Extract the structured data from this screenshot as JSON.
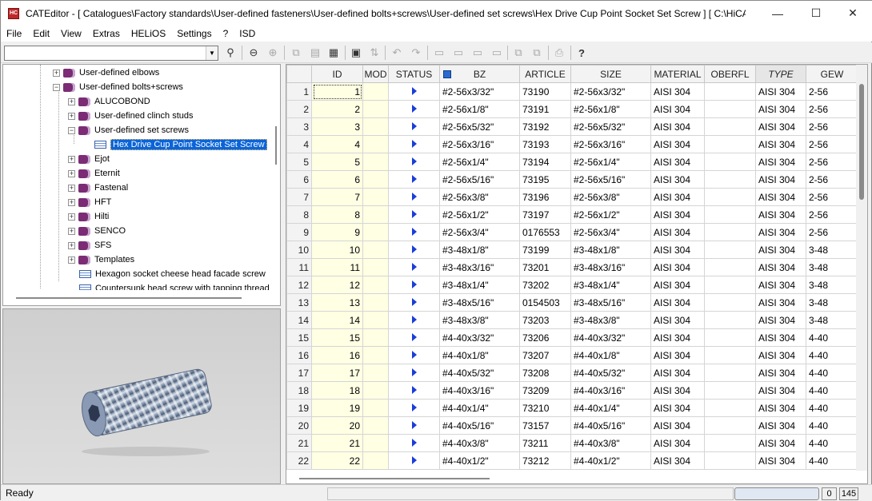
{
  "window": {
    "title": "CATEditor - [ Catalogues\\Factory standards\\User-defined fasteners\\User-defined bolts+screws\\User-defined  set screws\\Hex Drive Cup Point Socket Set Screw ]     [ C:\\HiCA...",
    "app_icon": "HiCAD",
    "minimize_glyph": "—",
    "maximize_glyph": "☐",
    "close_glyph": "✕"
  },
  "menu": [
    "File",
    "Edit",
    "View",
    "Extras",
    "HELiOS",
    "Settings",
    "?",
    "ISD"
  ],
  "toolbar": {
    "combo_value": "",
    "icons": [
      "binoculars-icon",
      "back-icon",
      "forward-icon",
      "copy-icon",
      "paste-icon",
      "list-icon",
      "save-icon",
      "sort-icon",
      "undo-icon",
      "redo-icon",
      "add-row-icon",
      "add-col-icon",
      "add-row-below-icon",
      "delete-row-icon",
      "copy-rows-icon",
      "paste-rows-icon",
      "print-icon",
      "help-icon"
    ]
  },
  "tree": {
    "items": [
      {
        "label": "User-defined elbows",
        "icon": "book",
        "expander": "+"
      },
      {
        "label": "User-defined bolts+screws",
        "icon": "book",
        "expander": "−"
      },
      {
        "label": "ALUCOBOND",
        "icon": "book",
        "expander": "+"
      },
      {
        "label": "User-defined clinch studs",
        "icon": "book",
        "expander": "+"
      },
      {
        "label": "User-defined  set screws",
        "icon": "book",
        "expander": "−"
      },
      {
        "label": "Hex Drive Cup Point Socket Set Screw",
        "icon": "table",
        "expander": ""
      },
      {
        "label": "Ejot",
        "icon": "book",
        "expander": "+"
      },
      {
        "label": "Eternit",
        "icon": "book",
        "expander": "+"
      },
      {
        "label": "Fastenal",
        "icon": "book",
        "expander": "+"
      },
      {
        "label": "HFT",
        "icon": "book",
        "expander": "+"
      },
      {
        "label": "Hilti",
        "icon": "book",
        "expander": "+"
      },
      {
        "label": "SENCO",
        "icon": "book",
        "expander": "+"
      },
      {
        "label": "SFS",
        "icon": "book",
        "expander": "+"
      },
      {
        "label": "Templates",
        "icon": "book",
        "expander": "+"
      },
      {
        "label": "Hexagon socket cheese head facade screw",
        "icon": "table",
        "expander": ""
      },
      {
        "label": "Countersunk head screw with tapping thread",
        "icon": "table",
        "expander": ""
      }
    ]
  },
  "table": {
    "columns": [
      "ID",
      "MOD",
      "STATUS",
      "BZ",
      "ARTICLE",
      "SIZE",
      "MATERIAL",
      "OBERFL",
      "TYPE",
      "GEW"
    ],
    "rows": [
      {
        "n": "1",
        "id": "1",
        "bz": "#2-56x3/32\"",
        "article": "73190",
        "size": "#2-56x3/32\"",
        "material": "AISI 304",
        "oberfl": "",
        "type": "AISI 304",
        "gew": "2-56"
      },
      {
        "n": "2",
        "id": "2",
        "bz": "#2-56x1/8\"",
        "article": "73191",
        "size": "#2-56x1/8\"",
        "material": "AISI 304",
        "oberfl": "",
        "type": "AISI 304",
        "gew": "2-56"
      },
      {
        "n": "3",
        "id": "3",
        "bz": "#2-56x5/32\"",
        "article": "73192",
        "size": "#2-56x5/32\"",
        "material": "AISI 304",
        "oberfl": "",
        "type": "AISI 304",
        "gew": "2-56"
      },
      {
        "n": "4",
        "id": "4",
        "bz": "#2-56x3/16\"",
        "article": "73193",
        "size": "#2-56x3/16\"",
        "material": "AISI 304",
        "oberfl": "",
        "type": "AISI 304",
        "gew": "2-56"
      },
      {
        "n": "5",
        "id": "5",
        "bz": "#2-56x1/4\"",
        "article": "73194",
        "size": "#2-56x1/4\"",
        "material": "AISI 304",
        "oberfl": "",
        "type": "AISI 304",
        "gew": "2-56"
      },
      {
        "n": "6",
        "id": "6",
        "bz": "#2-56x5/16\"",
        "article": "73195",
        "size": "#2-56x5/16\"",
        "material": "AISI 304",
        "oberfl": "",
        "type": "AISI 304",
        "gew": "2-56"
      },
      {
        "n": "7",
        "id": "7",
        "bz": "#2-56x3/8\"",
        "article": "73196",
        "size": "#2-56x3/8\"",
        "material": "AISI 304",
        "oberfl": "",
        "type": "AISI 304",
        "gew": "2-56"
      },
      {
        "n": "8",
        "id": "8",
        "bz": "#2-56x1/2\"",
        "article": "73197",
        "size": "#2-56x1/2\"",
        "material": "AISI 304",
        "oberfl": "",
        "type": "AISI 304",
        "gew": "2-56"
      },
      {
        "n": "9",
        "id": "9",
        "bz": "#2-56x3/4\"",
        "article": "0176553",
        "size": "#2-56x3/4\"",
        "material": "AISI 304",
        "oberfl": "",
        "type": "AISI 304",
        "gew": "2-56"
      },
      {
        "n": "10",
        "id": "10",
        "bz": "#3-48x1/8\"",
        "article": "73199",
        "size": "#3-48x1/8\"",
        "material": "AISI 304",
        "oberfl": "",
        "type": "AISI 304",
        "gew": "3-48"
      },
      {
        "n": "11",
        "id": "11",
        "bz": "#3-48x3/16\"",
        "article": "73201",
        "size": "#3-48x3/16\"",
        "material": "AISI 304",
        "oberfl": "",
        "type": "AISI 304",
        "gew": "3-48"
      },
      {
        "n": "12",
        "id": "12",
        "bz": "#3-48x1/4\"",
        "article": "73202",
        "size": "#3-48x1/4\"",
        "material": "AISI 304",
        "oberfl": "",
        "type": "AISI 304",
        "gew": "3-48"
      },
      {
        "n": "13",
        "id": "13",
        "bz": "#3-48x5/16\"",
        "article": "0154503",
        "size": "#3-48x5/16\"",
        "material": "AISI 304",
        "oberfl": "",
        "type": "AISI 304",
        "gew": "3-48"
      },
      {
        "n": "14",
        "id": "14",
        "bz": "#3-48x3/8\"",
        "article": "73203",
        "size": "#3-48x3/8\"",
        "material": "AISI 304",
        "oberfl": "",
        "type": "AISI 304",
        "gew": "3-48"
      },
      {
        "n": "15",
        "id": "15",
        "bz": "#4-40x3/32\"",
        "article": "73206",
        "size": "#4-40x3/32\"",
        "material": "AISI 304",
        "oberfl": "",
        "type": "AISI 304",
        "gew": "4-40"
      },
      {
        "n": "16",
        "id": "16",
        "bz": "#4-40x1/8\"",
        "article": "73207",
        "size": "#4-40x1/8\"",
        "material": "AISI 304",
        "oberfl": "",
        "type": "AISI 304",
        "gew": "4-40"
      },
      {
        "n": "17",
        "id": "17",
        "bz": "#4-40x5/32\"",
        "article": "73208",
        "size": "#4-40x5/32\"",
        "material": "AISI 304",
        "oberfl": "",
        "type": "AISI 304",
        "gew": "4-40"
      },
      {
        "n": "18",
        "id": "18",
        "bz": "#4-40x3/16\"",
        "article": "73209",
        "size": "#4-40x3/16\"",
        "material": "AISI 304",
        "oberfl": "",
        "type": "AISI 304",
        "gew": "4-40"
      },
      {
        "n": "19",
        "id": "19",
        "bz": "#4-40x1/4\"",
        "article": "73210",
        "size": "#4-40x1/4\"",
        "material": "AISI 304",
        "oberfl": "",
        "type": "AISI 304",
        "gew": "4-40"
      },
      {
        "n": "20",
        "id": "20",
        "bz": "#4-40x5/16\"",
        "article": "73157",
        "size": "#4-40x5/16\"",
        "material": "AISI 304",
        "oberfl": "",
        "type": "AISI 304",
        "gew": "4-40"
      },
      {
        "n": "21",
        "id": "21",
        "bz": "#4-40x3/8\"",
        "article": "73211",
        "size": "#4-40x3/8\"",
        "material": "AISI 304",
        "oberfl": "",
        "type": "AISI 304",
        "gew": "4-40"
      },
      {
        "n": "22",
        "id": "22",
        "bz": "#4-40x1/2\"",
        "article": "73212",
        "size": "#4-40x1/2\"",
        "material": "AISI 304",
        "oberfl": "",
        "type": "AISI 304",
        "gew": "4-40"
      }
    ]
  },
  "status": {
    "text": "Ready",
    "count1": "0",
    "count2": "145"
  },
  "colors": {
    "selection": "#0a64d8",
    "id_column": "#ffffe4",
    "status_arrow": "#1b3dd8",
    "book_icon": "#7b2c75"
  }
}
